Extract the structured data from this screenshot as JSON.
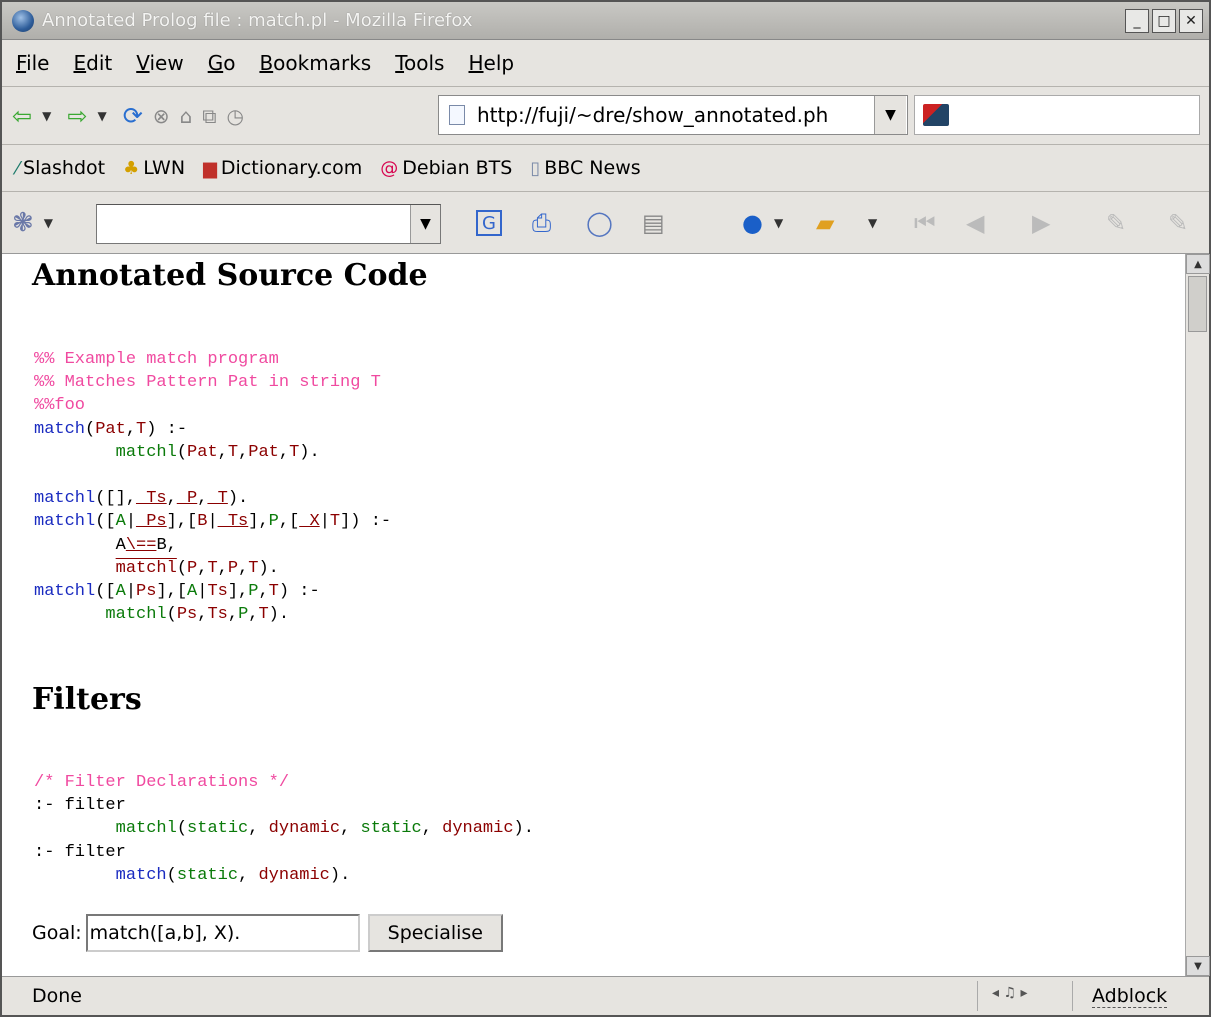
{
  "window": {
    "title": "Annotated Prolog file : match.pl - Mozilla Firefox",
    "controls": [
      "_",
      "□",
      "✕"
    ]
  },
  "menu": [
    "File",
    "Edit",
    "View",
    "Go",
    "Bookmarks",
    "Tools",
    "Help"
  ],
  "menu_access": [
    "F",
    "E",
    "V",
    "G",
    "B",
    "T",
    "H"
  ],
  "nav": {
    "url": "http://fuji/~dre/show_annotated.ph",
    "icons": [
      "back-icon",
      "forward-icon",
      "reload-icon",
      "stop-icon",
      "home-icon",
      "new-window-icon",
      "history-icon"
    ]
  },
  "bookmarks": [
    {
      "label": "Slashdot",
      "icon": "slashdot-icon"
    },
    {
      "label": "LWN",
      "icon": "lwn-icon"
    },
    {
      "label": "Dictionary.com",
      "icon": "dictionary-icon"
    },
    {
      "label": "Debian BTS",
      "icon": "debian-icon"
    },
    {
      "label": "BBC News",
      "icon": "page-icon"
    }
  ],
  "googlebar": {
    "search_value": ""
  },
  "content": {
    "heading1": "Annotated Source Code",
    "heading2": "Filters",
    "goal_label": "Goal:",
    "goal_value": "match([a,b], X).",
    "specialise_label": "Specialise"
  },
  "status": {
    "text": "Done",
    "adblock": "Adblock"
  },
  "colors": {
    "comment": "#f04aa0",
    "predicate": "#1a2bc0",
    "variable": "#8b0000",
    "static": "#0a7a0a"
  }
}
